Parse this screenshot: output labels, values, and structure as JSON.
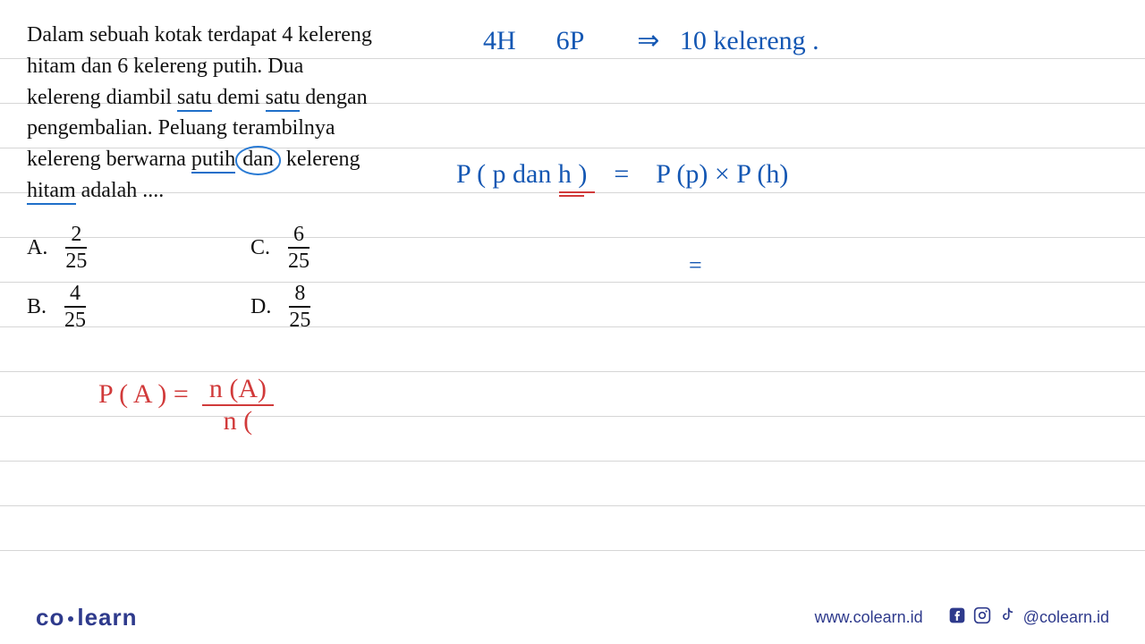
{
  "question": {
    "line1": "Dalam sebuah kotak terdapat 4 kelereng",
    "line2a": "hitam dan 6 kelereng putih. Dua",
    "line3a": "kelereng diambil ",
    "line3_u1": "satu",
    "line3b": " demi ",
    "line3_u2": "satu",
    "line3c": " dengan",
    "line4a": "pengembalian. Peluang terambilnya",
    "line5a": "kelereng berwarna ",
    "line5_u1": "putih",
    "line5_circ": "dan",
    "line5b": " kelereng",
    "line6a": "hitam",
    "line6b": " adalah ...."
  },
  "options": {
    "A": {
      "letter": "A.",
      "num": "2",
      "den": "25"
    },
    "B": {
      "letter": "B.",
      "num": "4",
      "den": "25"
    },
    "C": {
      "letter": "C.",
      "num": "6",
      "den": "25"
    },
    "D": {
      "letter": "D.",
      "num": "8",
      "den": "25"
    }
  },
  "hand": {
    "top": {
      "h": "4H",
      "p": "6P",
      "arrow": "⇒",
      "total": "10  kelereng ."
    },
    "eq1_left": "P ( p dan h )",
    "eq1_eq": "=",
    "eq1_right": "P (p)   ×  P (h)",
    "eq2_eq": "=",
    "formula_left": "P ( A ) =",
    "formula_num": "n (A)",
    "formula_den": "n ( "
  },
  "footer": {
    "logo_a": "co",
    "logo_b": "learn",
    "url": "www.colearn.id",
    "handle": "@colearn.id"
  }
}
